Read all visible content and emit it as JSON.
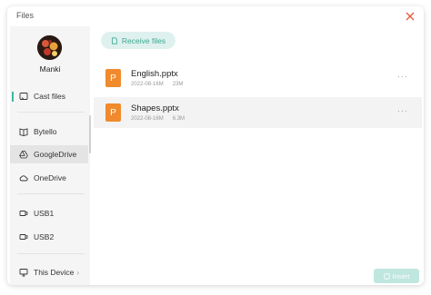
{
  "window": {
    "title": "Files"
  },
  "user": {
    "name": "Manki"
  },
  "sidebar": {
    "items": [
      {
        "label": "Cast files",
        "icon": "cast-icon"
      },
      {
        "label": "Bytello",
        "icon": "book-icon"
      },
      {
        "label": "GoogleDrive",
        "icon": "google-drive-icon"
      },
      {
        "label": "OneDrive",
        "icon": "cloud-icon"
      },
      {
        "label": "USB1",
        "icon": "usb-icon"
      },
      {
        "label": "USB2",
        "icon": "usb-icon"
      },
      {
        "label": "This Device",
        "icon": "monitor-icon"
      }
    ]
  },
  "main": {
    "receive_label": "Receive files",
    "files": [
      {
        "name": "English.pptx",
        "date": "2022-08-16M",
        "size": "23M",
        "icon_letter": "P"
      },
      {
        "name": "Shapes.pptx",
        "date": "2022-08-16M",
        "size": "6.3M",
        "icon_letter": "P"
      }
    ],
    "more_label": "···",
    "insert_label": "Insert"
  },
  "colors": {
    "accent": "#3aa893",
    "file_icon": "#f08a2c",
    "close": "#e05a3a"
  }
}
